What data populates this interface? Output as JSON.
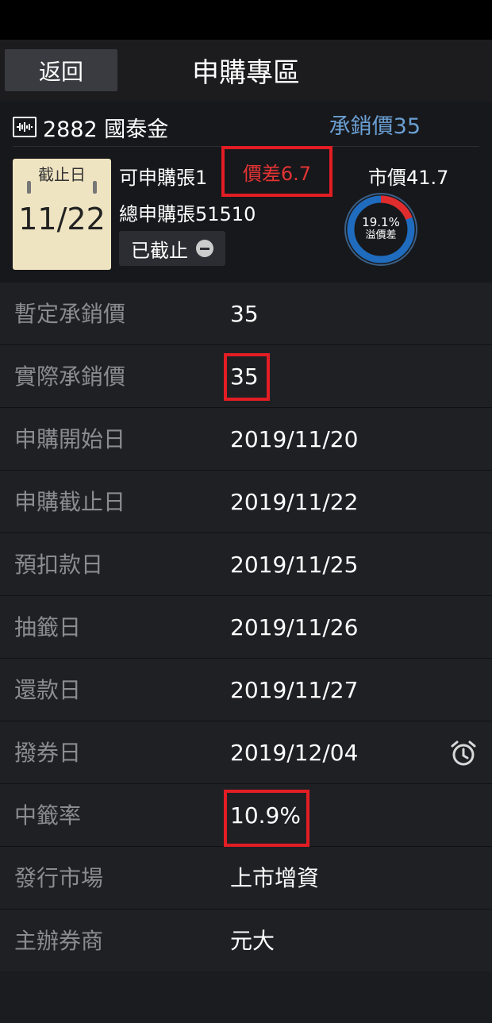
{
  "header": {
    "back_label": "返回",
    "title": "申購專區"
  },
  "stock": {
    "icon": "chart-icon",
    "name": "2882 國泰金",
    "underwrite_price": "承銷價35",
    "calendar_header": "截止日",
    "calendar_date": "11/22",
    "subscribe_count": "可申購張1",
    "price_diff": "價差6.7",
    "market_price": "市價41.7",
    "total_subscribe": "總申購張51510",
    "status": "已截止",
    "premium_pct": "19.1%",
    "premium_label": "溢價差",
    "premium_value": 19.1,
    "colors": {
      "accent_blue": "#6a9fd3",
      "diff_red": "#e23434",
      "highlight": "#e21d24",
      "ring_blue": "#1f6cbf",
      "ring_red": "#e02c2c"
    }
  },
  "details": [
    {
      "label": "暫定承銷價",
      "value": "35"
    },
    {
      "label": "實際承銷價",
      "value": "35"
    },
    {
      "label": "申購開始日",
      "value": "2019/11/20"
    },
    {
      "label": "申購截止日",
      "value": "2019/11/22"
    },
    {
      "label": "預扣款日",
      "value": "2019/11/25"
    },
    {
      "label": "抽籤日",
      "value": "2019/11/26"
    },
    {
      "label": "還款日",
      "value": "2019/11/27"
    },
    {
      "label": "撥券日",
      "value": "2019/12/04",
      "icon": "alarm-clock-icon"
    },
    {
      "label": "中籤率",
      "value": "10.9%"
    },
    {
      "label": "發行市場",
      "value": "上市增資"
    },
    {
      "label": "主辦券商",
      "value": "元大"
    }
  ]
}
